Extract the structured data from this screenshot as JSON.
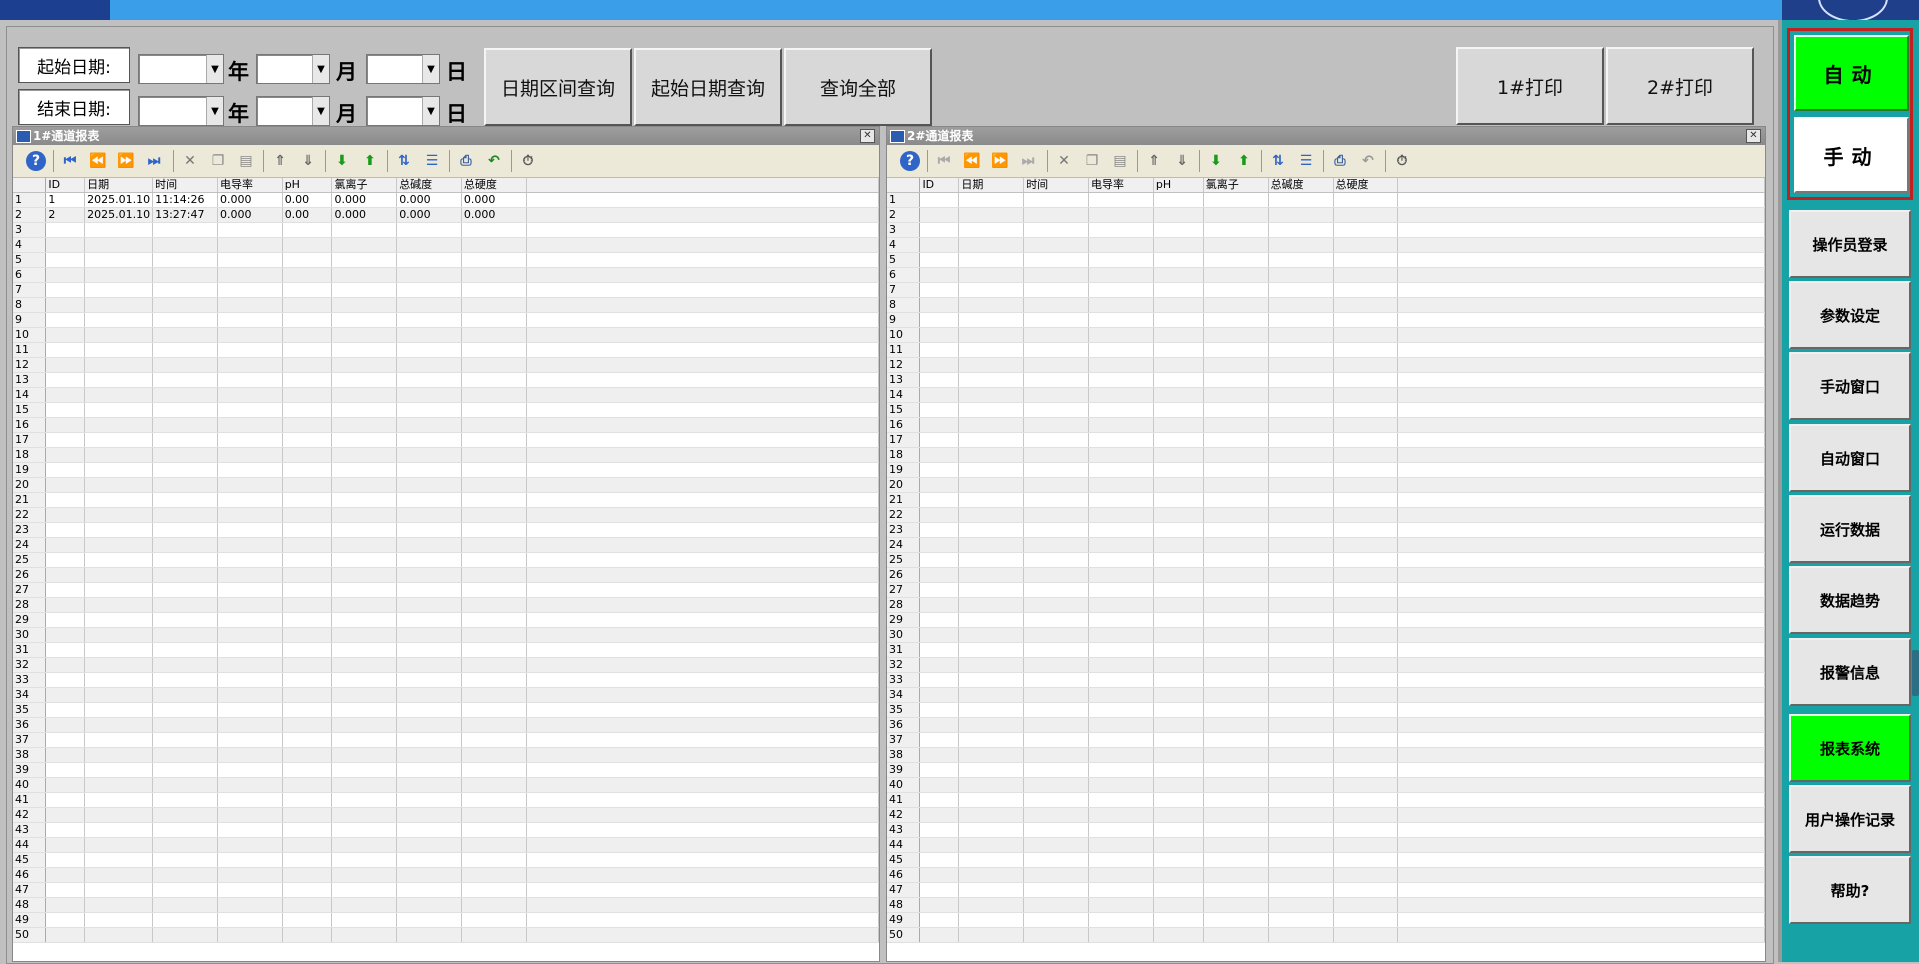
{
  "query": {
    "start_label": "起始日期:",
    "end_label": "结束日期:",
    "year": "年",
    "month": "月",
    "day": "日",
    "btn_range": "日期区间查询",
    "btn_start": "起始日期查询",
    "btn_all": "查询全部",
    "btn_print1": "1#打印",
    "btn_print2": "2#打印"
  },
  "panel1": {
    "title": "1#通道报表",
    "columns": [
      "ID",
      "日期",
      "时间",
      "电导率",
      "pH",
      "氯离子",
      "总碱度",
      "总硬度"
    ],
    "rows": [
      [
        "1",
        "2025.01.10",
        "11:14:26",
        "0.000",
        "0.00",
        "0.000",
        "0.000",
        "0.000"
      ],
      [
        "2",
        "2025.01.10",
        "13:27:47",
        "0.000",
        "0.00",
        "0.000",
        "0.000",
        "0.000"
      ]
    ]
  },
  "panel2": {
    "title": "2#通道报表",
    "columns": [
      "ID",
      "日期",
      "时间",
      "电导率",
      "pH",
      "氯离子",
      "总碱度",
      "总硬度"
    ],
    "rows": []
  },
  "row_count": 50,
  "side": {
    "auto": "自动",
    "manual": "手动",
    "nav": [
      "操作员登录",
      "参数设定",
      "手动窗口",
      "自动窗口",
      "运行数据",
      "数据趋势",
      "报警信息",
      "报表系统",
      "用户操作记录",
      "帮助?"
    ],
    "active_nav": "报表系统"
  },
  "colors": {
    "accent_green": "#00ff00",
    "side_teal": "#17a3a6",
    "mode_border": "#c02020"
  }
}
